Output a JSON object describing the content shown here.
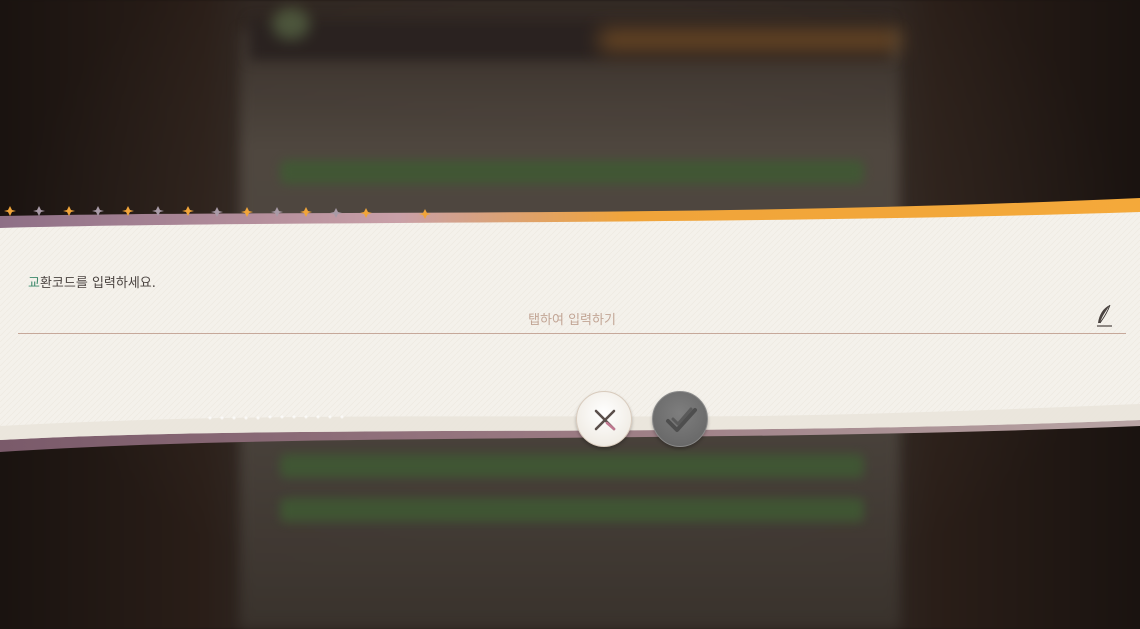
{
  "dialog": {
    "prompt_accent": "교",
    "prompt_rest": "환코드를 입력하세요.",
    "input_placeholder": "탭하여 입력하기"
  },
  "buttons": {
    "cancel_icon": "close-icon",
    "confirm_icon": "check-icon"
  },
  "icons": {
    "input_icon": "quill-icon"
  },
  "colors": {
    "banner_bg": "#f4f1eb",
    "accent_orange": "#f0a43a",
    "accent_mauve": "#8c6e78",
    "prompt_accent": "#3e8a6c",
    "placeholder": "#c2a595"
  }
}
